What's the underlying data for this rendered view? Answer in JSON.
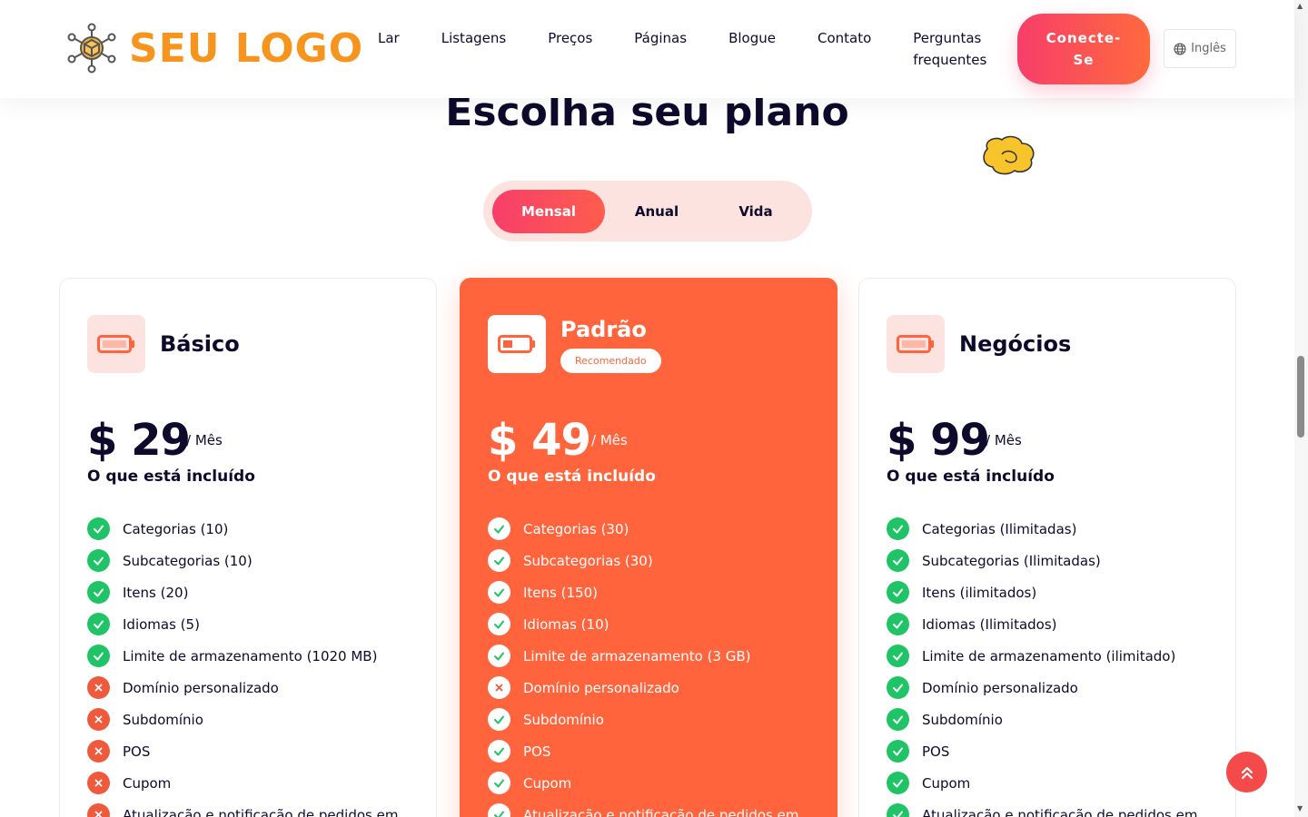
{
  "header": {
    "logo_text": "SEU LOGO",
    "nav": [
      "Lar",
      "Listagens",
      "Preços",
      "Páginas",
      "Blogue",
      "Contato"
    ],
    "nav_faq_line1": "Perguntas",
    "nav_faq_line2": "frequentes",
    "connect_line1": "Conecte-",
    "connect_line2": "Se",
    "language": "Inglês"
  },
  "page": {
    "title": "Escolha seu plano"
  },
  "toggle": {
    "options": [
      "Mensal",
      "Anual",
      "Vida"
    ],
    "active": "Mensal"
  },
  "plans": [
    {
      "name": "Básico",
      "price": "$ 29",
      "period": "/ Mês",
      "included": "O que está incluído",
      "features": [
        {
          "text": "Categorias (10)",
          "ok": true
        },
        {
          "text": "Subcategorias (10)",
          "ok": true
        },
        {
          "text": "Itens (20)",
          "ok": true
        },
        {
          "text": "Idiomas (5)",
          "ok": true
        },
        {
          "text": "Limite de armazenamento (1020 MB)",
          "ok": true
        },
        {
          "text": "Domínio personalizado",
          "ok": false
        },
        {
          "text": "Subdomínio",
          "ok": false
        },
        {
          "text": "POS",
          "ok": false
        },
        {
          "text": "Cupom",
          "ok": false
        },
        {
          "text": "Atualização e notificação de pedidos em",
          "ok": false
        }
      ]
    },
    {
      "name": "Padrão",
      "badge": "Recomendado",
      "price": "$ 49",
      "period": "/ Mês",
      "included": "O que está incluído",
      "features": [
        {
          "text": "Categorias (30)",
          "ok": true
        },
        {
          "text": "Subcategorias (30)",
          "ok": true
        },
        {
          "text": "Itens (150)",
          "ok": true
        },
        {
          "text": "Idiomas (10)",
          "ok": true
        },
        {
          "text": "Limite de armazenamento (3 GB)",
          "ok": true
        },
        {
          "text": "Domínio personalizado",
          "ok": false
        },
        {
          "text": "Subdomínio",
          "ok": true
        },
        {
          "text": "POS",
          "ok": true
        },
        {
          "text": "Cupom",
          "ok": true
        },
        {
          "text": "Atualização e notificação de pedidos em",
          "ok": true
        }
      ]
    },
    {
      "name": "Negócios",
      "price": "$ 99",
      "period": "/ Mês",
      "included": "O que está incluído",
      "features": [
        {
          "text": "Categorias (Ilimitadas)",
          "ok": true
        },
        {
          "text": "Subcategorias (Ilimitadas)",
          "ok": true
        },
        {
          "text": "Itens (ilimitados)",
          "ok": true
        },
        {
          "text": "Idiomas (Ilimitados)",
          "ok": true
        },
        {
          "text": "Limite de armazenamento (ilimitado)",
          "ok": true
        },
        {
          "text": "Domínio personalizado",
          "ok": true
        },
        {
          "text": "Subdomínio",
          "ok": true
        },
        {
          "text": "POS",
          "ok": true
        },
        {
          "text": "Cupom",
          "ok": true
        },
        {
          "text": "Atualização e notificação de pedidos em",
          "ok": true
        }
      ]
    }
  ],
  "colors": {
    "brand_orange": "#f7941d",
    "accent": "#ff643d",
    "gradient_start": "#f73e6a",
    "check_green": "#1ec465",
    "cross_red": "#ef5a3c"
  },
  "icons": {
    "feature_ok": "check-icon",
    "feature_no": "cross-icon",
    "plan": "battery-icon",
    "language": "globe-icon",
    "scroll_top": "double-chevron-up-icon"
  }
}
